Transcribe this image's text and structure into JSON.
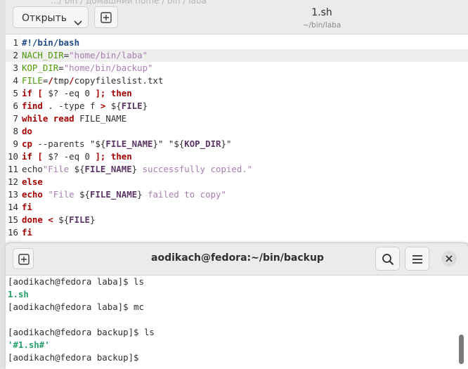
{
  "editor": {
    "ghost_title": "…/ bin /  домашний home  /  bin  /  laba",
    "open_button_label": "Открыть",
    "doc_title": "1.sh",
    "doc_path": "~/bin/laba",
    "lines": [
      {
        "num": "1",
        "tokens": [
          {
            "t": "#!/bin/bash",
            "c": "pp"
          }
        ]
      },
      {
        "num": "2",
        "tokens": [
          {
            "t": "NACH_DIR",
            "c": "vr"
          },
          {
            "t": "=",
            "c": ""
          },
          {
            "t": "\"home/bin/laba\"",
            "c": "st"
          }
        ]
      },
      {
        "num": "3",
        "tokens": [
          {
            "t": "KOP_DIR",
            "c": "vr"
          },
          {
            "t": "=",
            "c": ""
          },
          {
            "t": "\"home/bin/backup\"",
            "c": "st"
          }
        ]
      },
      {
        "num": "4",
        "tokens": [
          {
            "t": "FILE",
            "c": "vr"
          },
          {
            "t": "=",
            "c": ""
          },
          {
            "t": "/",
            "c": "rd"
          },
          {
            "t": "tmp",
            "c": ""
          },
          {
            "t": "/",
            "c": "rd"
          },
          {
            "t": "copyfileslist.txt",
            "c": ""
          }
        ]
      },
      {
        "num": "5",
        "tokens": [
          {
            "t": "if",
            "c": "kw"
          },
          {
            "t": " ",
            "c": ""
          },
          {
            "t": "[",
            "c": "kw"
          },
          {
            "t": " $? -eq 0 ",
            "c": ""
          },
          {
            "t": "];",
            "c": "kw"
          },
          {
            "t": " ",
            "c": ""
          },
          {
            "t": "then",
            "c": "kw"
          }
        ]
      },
      {
        "num": "6",
        "tokens": [
          {
            "t": "find",
            "c": "kw"
          },
          {
            "t": " . -type f ",
            "c": ""
          },
          {
            "t": ">",
            "c": "kw"
          },
          {
            "t": " ${",
            "c": ""
          },
          {
            "t": "FILE",
            "c": "vb"
          },
          {
            "t": "}",
            "c": ""
          }
        ]
      },
      {
        "num": "7",
        "tokens": [
          {
            "t": "while",
            "c": "kw"
          },
          {
            "t": " ",
            "c": ""
          },
          {
            "t": "read",
            "c": "kw"
          },
          {
            "t": " FILE_NAME",
            "c": ""
          }
        ]
      },
      {
        "num": "8",
        "tokens": [
          {
            "t": "do",
            "c": "kw"
          }
        ]
      },
      {
        "num": "9",
        "tokens": [
          {
            "t": "cp",
            "c": "kw"
          },
          {
            "t": " --parents \"${",
            "c": ""
          },
          {
            "t": "FILE_NAME",
            "c": "vb"
          },
          {
            "t": "}\" \"${",
            "c": ""
          },
          {
            "t": "KOP_DIR",
            "c": "vb"
          },
          {
            "t": "}\"",
            "c": ""
          }
        ]
      },
      {
        "num": "10",
        "tokens": [
          {
            "t": "if",
            "c": "kw"
          },
          {
            "t": " ",
            "c": ""
          },
          {
            "t": "[",
            "c": "kw"
          },
          {
            "t": " $? -eq 0 ",
            "c": ""
          },
          {
            "t": "];",
            "c": "kw"
          },
          {
            "t": " ",
            "c": ""
          },
          {
            "t": "then",
            "c": "kw"
          }
        ]
      },
      {
        "num": "11",
        "tokens": [
          {
            "t": "echo",
            "c": ""
          },
          {
            "t": "\"File ",
            "c": "st"
          },
          {
            "t": "${",
            "c": ""
          },
          {
            "t": "FILE_NAME",
            "c": "vb"
          },
          {
            "t": "}",
            "c": ""
          },
          {
            "t": " successfully copied.\"",
            "c": "st"
          }
        ]
      },
      {
        "num": "12",
        "tokens": [
          {
            "t": "else",
            "c": "kw"
          }
        ]
      },
      {
        "num": "13",
        "tokens": [
          {
            "t": "echo",
            "c": "kw"
          },
          {
            "t": " ",
            "c": ""
          },
          {
            "t": "\"File ",
            "c": "st"
          },
          {
            "t": "${",
            "c": ""
          },
          {
            "t": "FILE_NAME",
            "c": "vb"
          },
          {
            "t": "}",
            "c": ""
          },
          {
            "t": " failed to copy\"",
            "c": "st"
          }
        ]
      },
      {
        "num": "14",
        "tokens": [
          {
            "t": "fi",
            "c": "kw"
          }
        ]
      },
      {
        "num": "15",
        "tokens": [
          {
            "t": "done",
            "c": "kw"
          },
          {
            "t": " ",
            "c": ""
          },
          {
            "t": "<",
            "c": "kw"
          },
          {
            "t": " ${",
            "c": ""
          },
          {
            "t": "FILE",
            "c": "vb"
          },
          {
            "t": "}",
            "c": ""
          }
        ]
      },
      {
        "num": "16",
        "tokens": [
          {
            "t": "fi",
            "c": "kw"
          }
        ]
      }
    ],
    "current_line": 2
  },
  "terminal": {
    "title": "aodikach@fedora:~/bin/backup",
    "lines": [
      {
        "text": "[aodikach@fedora laba]$ ls",
        "cls": ""
      },
      {
        "text": "1.sh",
        "cls": "tg"
      },
      {
        "text": "[aodikach@fedora laba]$ mc",
        "cls": ""
      },
      {
        "text": "",
        "cls": ""
      },
      {
        "text": "[aodikach@fedora backup]$ ls",
        "cls": ""
      },
      {
        "text": "'#1.sh#'",
        "cls": "tg"
      },
      {
        "text": "[aodikach@fedora backup]$",
        "cls": ""
      }
    ]
  },
  "icons": {
    "open_dropdown": "chevron-down-icon",
    "new_document": "new-document-icon",
    "new_tab": "new-tab-icon",
    "search": "search-icon",
    "menu": "hamburger-menu-icon",
    "close": "close-icon"
  },
  "colors": {
    "keyword": "#a40000",
    "shebang": "#204a87",
    "variable": "#4e9a06",
    "string": "#a87db0",
    "var_ref": "#5c3566",
    "terminal_green": "#26a269"
  }
}
